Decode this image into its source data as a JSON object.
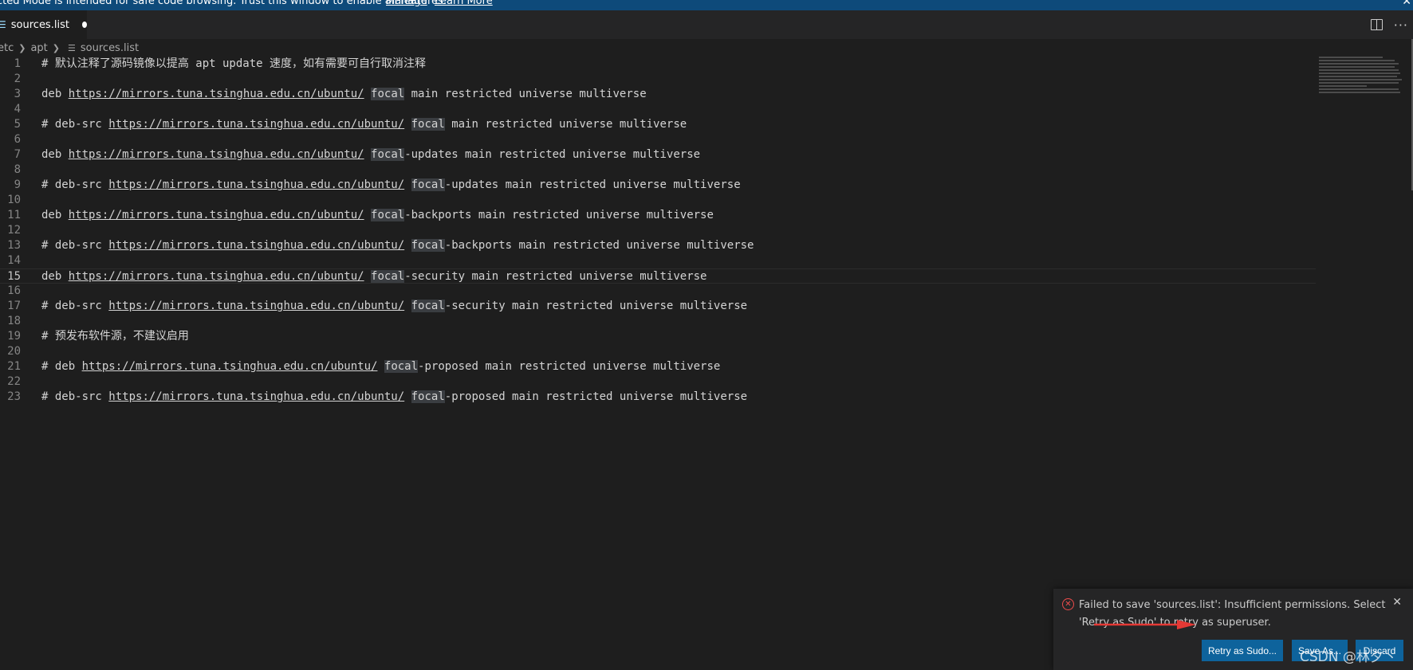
{
  "banner": {
    "text": "cted Mode is intended for safe code browsing. Trust this window to enable all features.",
    "manage_link": "Manage",
    "learn_more_link": "Learn More"
  },
  "tab": {
    "label": "sources.list",
    "icon": "file-icon",
    "dirty": true
  },
  "tab_actions": [
    "split-editor-icon",
    "more-actions-icon"
  ],
  "breadcrumb": {
    "items": [
      "etc",
      "apt",
      "sources.list"
    ]
  },
  "editor": {
    "active_line": 15,
    "lines": [
      {
        "n": "1",
        "text": "# 默认注释了源码镜像以提高 apt update 速度，如有需要可自行取消注释"
      },
      {
        "n": "2",
        "text": ""
      },
      {
        "n": "3",
        "pre": "deb ",
        "url": "https://mirrors.tuna.tsinghua.edu.cn/ubuntu/",
        "hl": "focal",
        "post": " main restricted universe multiverse"
      },
      {
        "n": "4",
        "text": ""
      },
      {
        "n": "5",
        "pre": "# deb-src ",
        "url": "https://mirrors.tuna.tsinghua.edu.cn/ubuntu/",
        "hl": "focal",
        "post": " main restricted universe multiverse"
      },
      {
        "n": "6",
        "text": ""
      },
      {
        "n": "7",
        "pre": "deb ",
        "url": "https://mirrors.tuna.tsinghua.edu.cn/ubuntu/",
        "hl": "focal",
        "post": "-updates main restricted universe multiverse"
      },
      {
        "n": "8",
        "text": ""
      },
      {
        "n": "9",
        "pre": "# deb-src ",
        "url": "https://mirrors.tuna.tsinghua.edu.cn/ubuntu/",
        "hl": "focal",
        "post": "-updates main restricted universe multiverse"
      },
      {
        "n": "10",
        "text": ""
      },
      {
        "n": "11",
        "pre": "deb ",
        "url": "https://mirrors.tuna.tsinghua.edu.cn/ubuntu/",
        "hl": "focal",
        "post": "-backports main restricted universe multiverse"
      },
      {
        "n": "12",
        "text": ""
      },
      {
        "n": "13",
        "pre": "# deb-src ",
        "url": "https://mirrors.tuna.tsinghua.edu.cn/ubuntu/",
        "hl": "focal",
        "post": "-backports main restricted universe multiverse"
      },
      {
        "n": "14",
        "text": ""
      },
      {
        "n": "15",
        "pre": "deb ",
        "url": "https://mirrors.tuna.tsinghua.edu.cn/ubuntu/",
        "hl": "focal",
        "post": "-security main restricted universe multiverse"
      },
      {
        "n": "16",
        "text": ""
      },
      {
        "n": "17",
        "pre": "# deb-src ",
        "url": "https://mirrors.tuna.tsinghua.edu.cn/ubuntu/",
        "hl": "focal",
        "post": "-security main restricted universe multiverse"
      },
      {
        "n": "18",
        "text": ""
      },
      {
        "n": "19",
        "text": "# 预发布软件源，不建议启用"
      },
      {
        "n": "20",
        "text": ""
      },
      {
        "n": "21",
        "pre": "# deb ",
        "url": "https://mirrors.tuna.tsinghua.edu.cn/ubuntu/",
        "hl": "focal",
        "post": "-proposed main restricted universe multiverse"
      },
      {
        "n": "22",
        "text": ""
      },
      {
        "n": "23",
        "pre": "# deb-src ",
        "url": "https://mirrors.tuna.tsinghua.edu.cn/ubuntu/",
        "hl": "focal",
        "post": "-proposed main restricted universe multiverse"
      }
    ]
  },
  "notification": {
    "icon": "error-icon",
    "message": "Failed to save 'sources.list': Insufficient permissions. Select 'Retry as Sudo' to retry as superuser.",
    "buttons": {
      "retry": "Retry as Sudo...",
      "save_as": "Save As...",
      "discard": "Discard"
    }
  },
  "watermark": "CSDN @林夕丶",
  "colors": {
    "banner_bg": "#0e4a7a",
    "button_bg": "#0e639c",
    "error": "#f14c4c",
    "arrow": "#e53935"
  }
}
